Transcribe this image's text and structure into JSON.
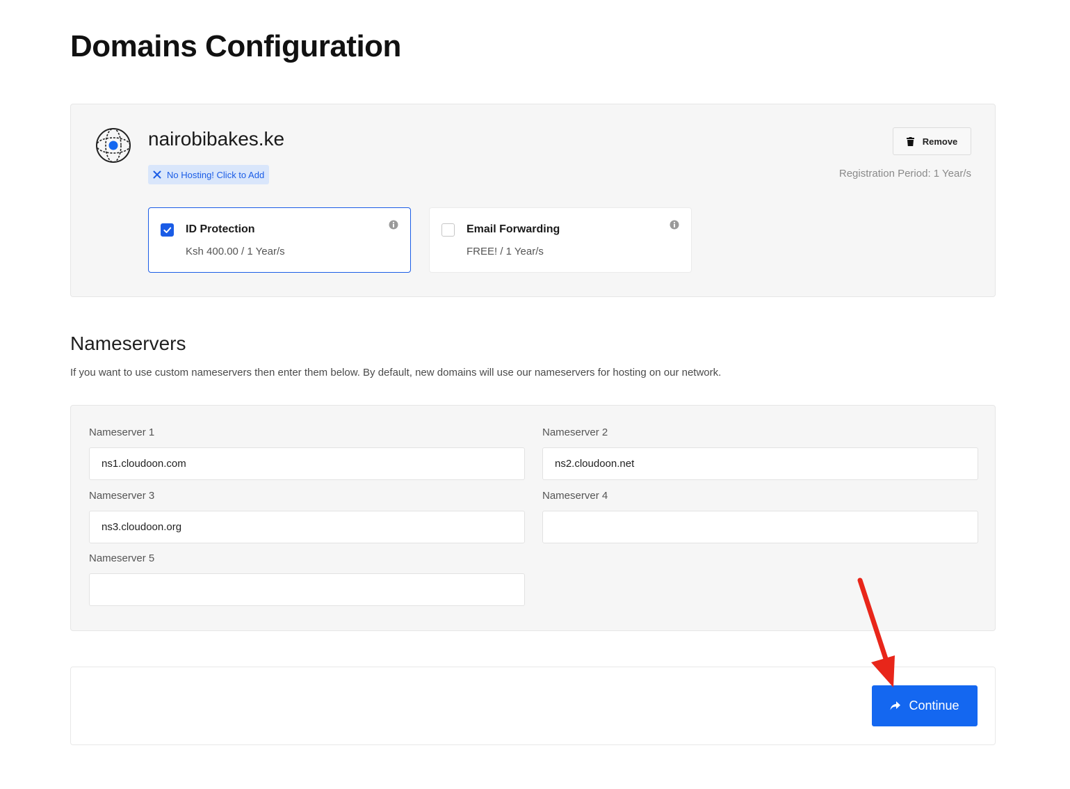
{
  "page": {
    "title": "Domains Configuration"
  },
  "domain": {
    "name": "nairobibakes.ke",
    "hosting_badge": "No Hosting! Click to Add",
    "remove_label": "Remove",
    "registration_period": "Registration Period: 1 Year/s",
    "addons": [
      {
        "title": "ID Protection",
        "price": "Ksh 400.00 / 1 Year/s",
        "checked": true
      },
      {
        "title": "Email Forwarding",
        "price": "FREE! / 1 Year/s",
        "checked": false
      }
    ]
  },
  "nameservers": {
    "heading": "Nameservers",
    "description": "If you want to use custom nameservers then enter them below. By default, new domains will use our nameservers for hosting on our network.",
    "fields": [
      {
        "label": "Nameserver 1",
        "value": "ns1.cloudoon.com"
      },
      {
        "label": "Nameserver 2",
        "value": "ns2.cloudoon.net"
      },
      {
        "label": "Nameserver 3",
        "value": "ns3.cloudoon.org"
      },
      {
        "label": "Nameserver 4",
        "value": ""
      },
      {
        "label": "Nameserver 5",
        "value": ""
      }
    ]
  },
  "footer": {
    "continue_label": "Continue"
  },
  "colors": {
    "accent": "#1467f0",
    "badge_bg": "#d9e6fb",
    "annotation": "#e8261a"
  },
  "icons": {
    "domain": "globe-icon",
    "badge": "x-icon",
    "remove": "trash-icon",
    "info": "info-icon",
    "continue": "share-arrow-icon",
    "check": "check-icon"
  }
}
